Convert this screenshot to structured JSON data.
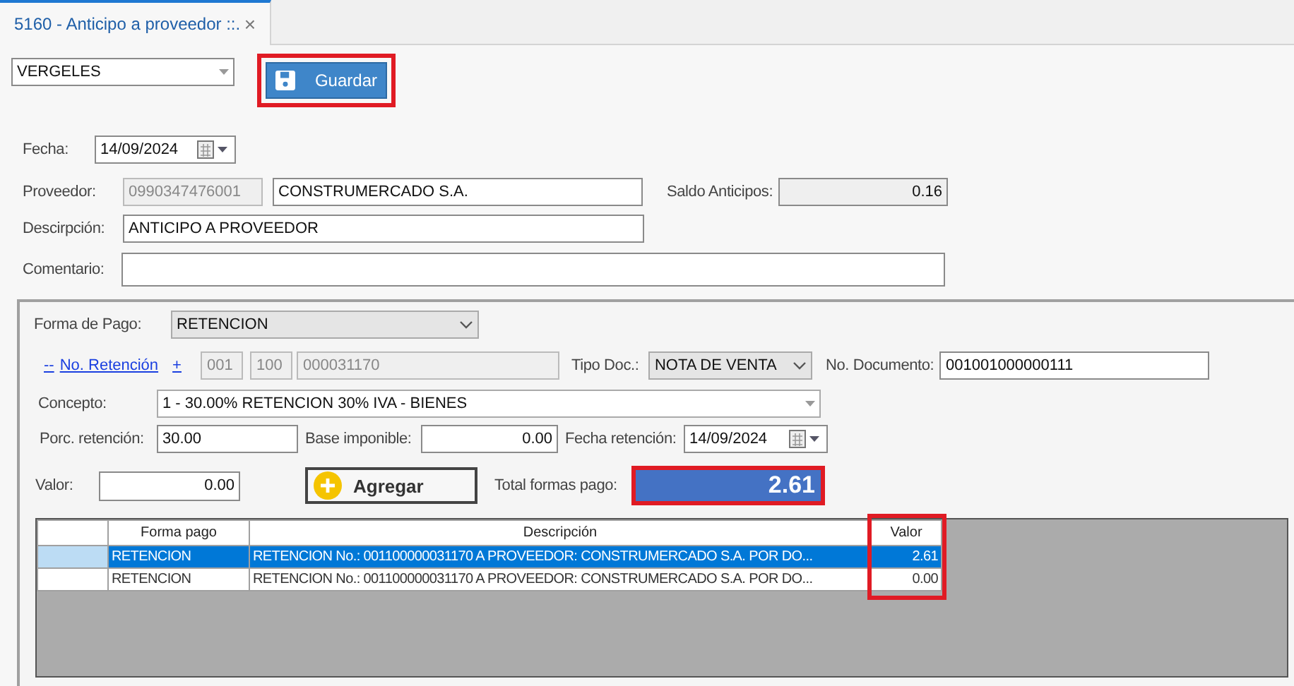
{
  "tab": {
    "title": "5160 - Anticipo a proveedor ::.",
    "close": "×",
    "selected": true
  },
  "sucursal": {
    "value": "VERGELES"
  },
  "save_button": {
    "label": "Guardar",
    "highlighted": true
  },
  "fecha": {
    "label": "Fecha:",
    "value": "14/09/2024"
  },
  "proveedor": {
    "label": "Proveedor:",
    "ruc": "0990347476001",
    "name": "CONSTRUMERCADO S.A."
  },
  "saldo_anticipos": {
    "label": "Saldo Anticipos:",
    "value": "0.16"
  },
  "descripcion": {
    "label": "Descirpción:",
    "value": "ANTICIPO A PROVEEDOR"
  },
  "comentario": {
    "label": "Comentario:"
  },
  "payment": {
    "forma_pago": {
      "label": "Forma de Pago:",
      "value": "RETENCION"
    },
    "retencion": {
      "collapse_link": "--",
      "label": "No. Retención",
      "add_link": "+",
      "establecimiento": "001",
      "punto_emision": "100",
      "secuencial": "000031170"
    },
    "tipo_doc": {
      "label": "Tipo Doc.:",
      "value": "NOTA DE VENTA"
    },
    "no_documento": {
      "label": "No. Documento:",
      "value": "001001000000111"
    },
    "concepto": {
      "label": "Concepto:",
      "value": "1 - 30.00% RETENCION 30% IVA - BIENES"
    },
    "porc_retencion": {
      "label": "Porc. retención:",
      "value": "30.00"
    },
    "base_imponible": {
      "label": "Base imponible:",
      "value": "0.00"
    },
    "fecha_retencion": {
      "label": "Fecha retención:",
      "value": "14/09/2024"
    },
    "valor": {
      "label": "Valor:",
      "value": "0.00"
    },
    "add_button": {
      "label": "Agregar"
    },
    "total": {
      "label": "Total formas pago:",
      "value": "2.61",
      "highlighted": true
    },
    "grid": {
      "columns": [
        {
          "label": "Forma pago",
          "highlighted": false
        },
        {
          "label": "Descripción",
          "highlighted": false
        },
        {
          "label": "Valor",
          "highlighted": true
        }
      ],
      "rows": [
        {
          "selected": true,
          "cells": [
            "RETENCION",
            "RETENCION No.: 001100000031170 A PROVEEDOR: CONSTRUMERCADO S.A. POR DO...",
            "2.61"
          ]
        },
        {
          "selected": false,
          "cells": [
            "RETENCION",
            "RETENCION No.: 001100000031170 A PROVEEDOR: CONSTRUMERCADO S.A. POR DO...",
            "0.00"
          ]
        }
      ]
    }
  }
}
